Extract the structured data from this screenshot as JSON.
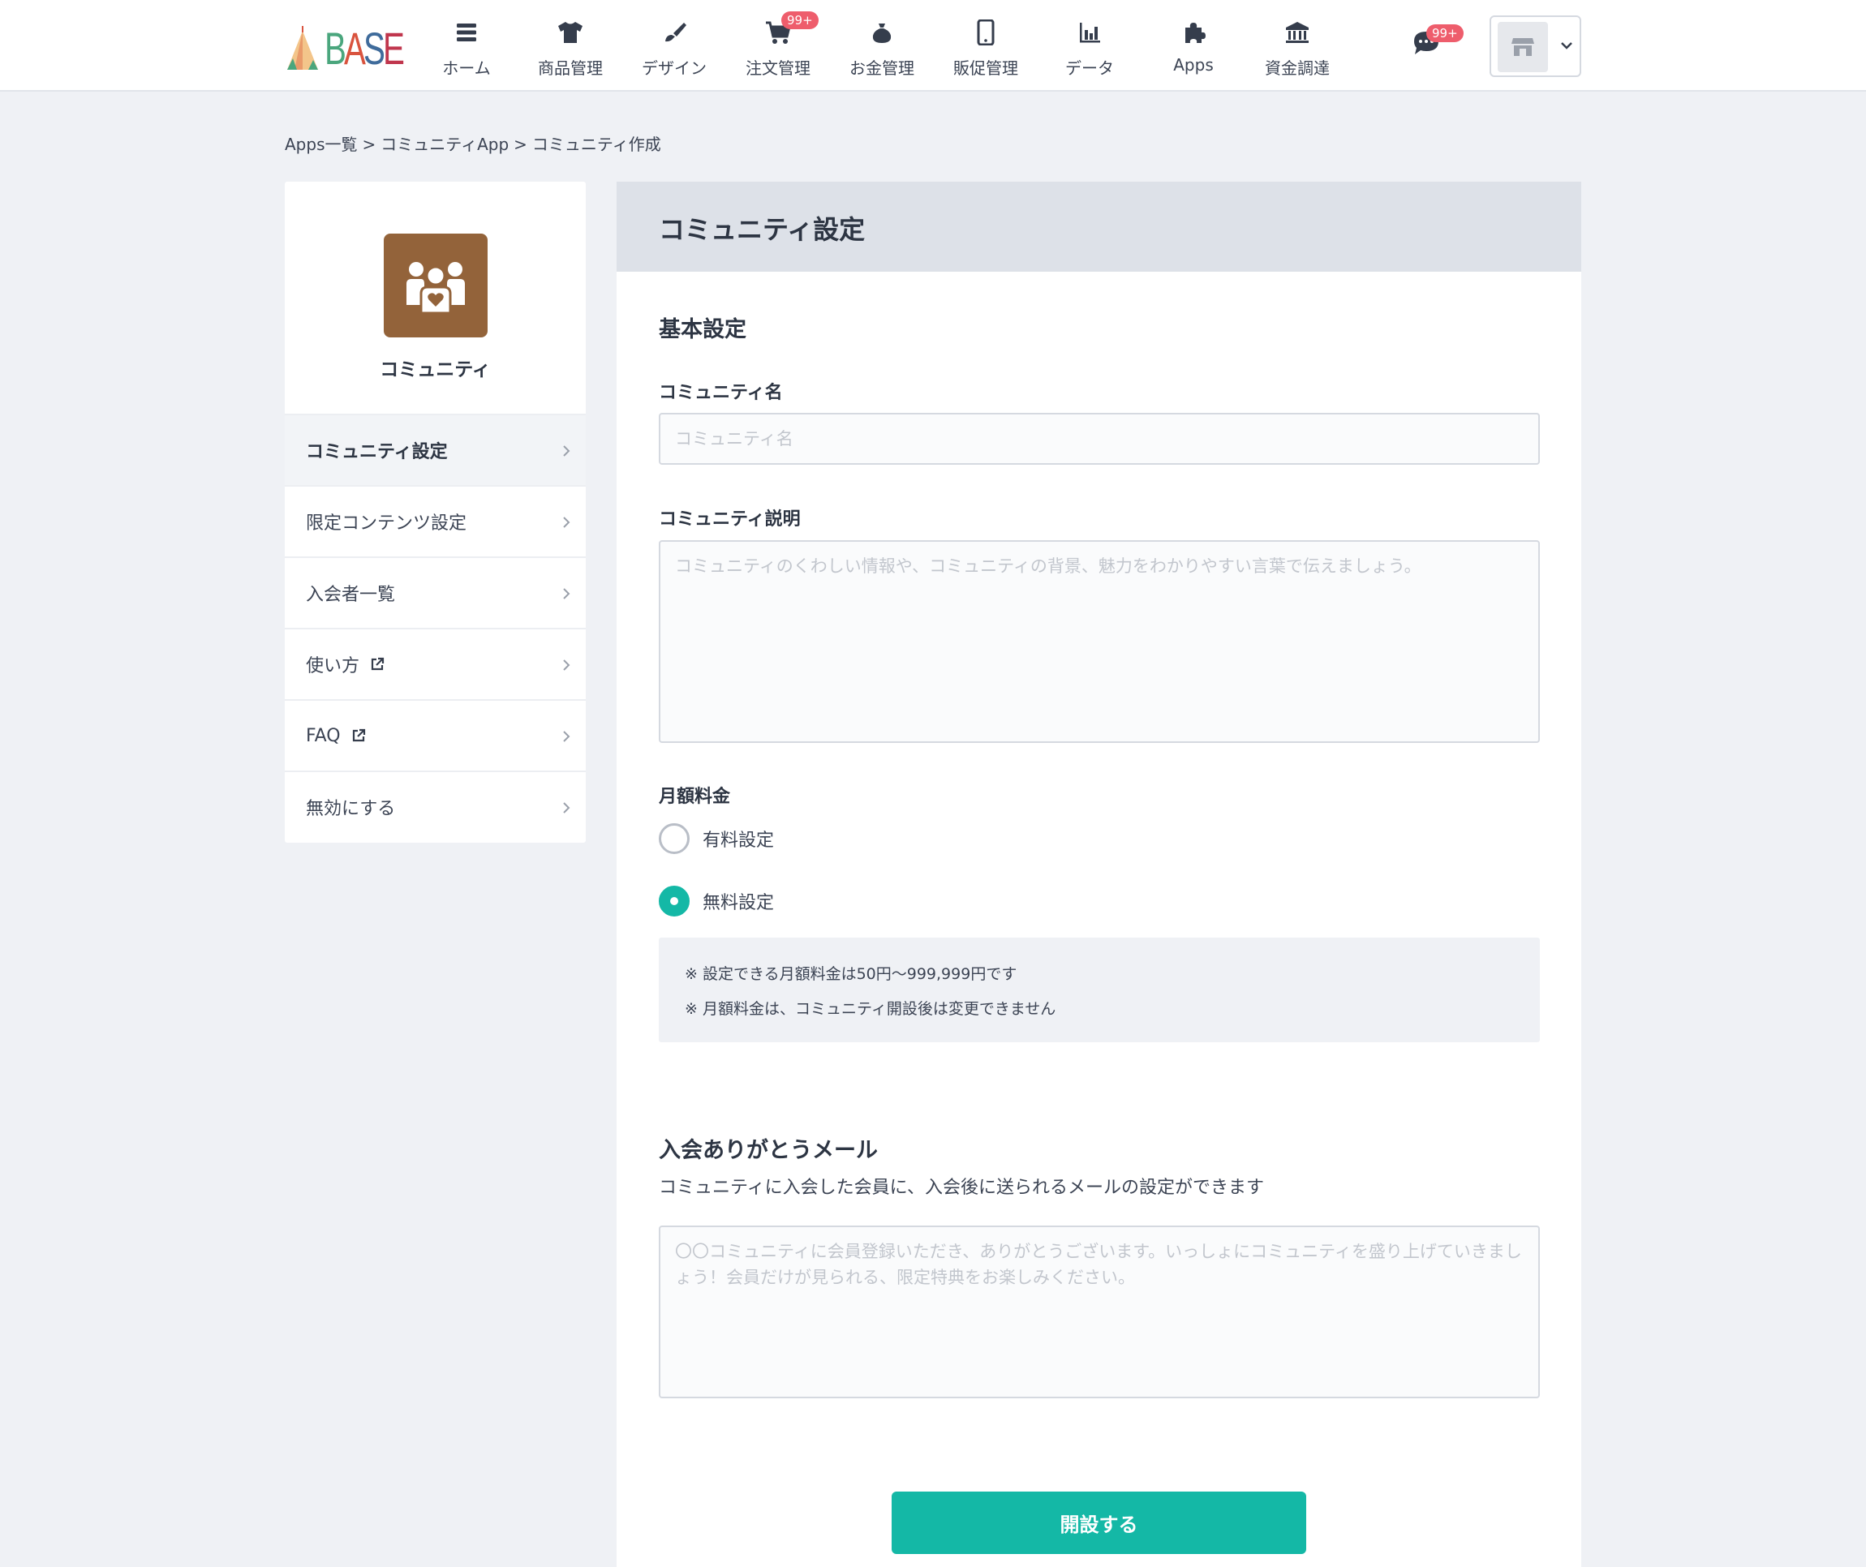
{
  "header": {
    "logo_text": "BASE",
    "nav": [
      {
        "label": "ホーム",
        "icon": "home-list-icon"
      },
      {
        "label": "商品管理",
        "icon": "tshirt-icon"
      },
      {
        "label": "デザイン",
        "icon": "brush-icon"
      },
      {
        "label": "注文管理",
        "icon": "cart-icon",
        "badge": "99+"
      },
      {
        "label": "お金管理",
        "icon": "money-bag-icon"
      },
      {
        "label": "販促管理",
        "icon": "smartphone-icon"
      },
      {
        "label": "データ",
        "icon": "bar-chart-icon"
      },
      {
        "label": "Apps",
        "icon": "puzzle-icon"
      },
      {
        "label": "資金調達",
        "icon": "bank-icon"
      }
    ],
    "chat_badge": "99+",
    "accent_color": "#14b8a6",
    "badge_color": "#ee5d6c"
  },
  "breadcrumb": [
    {
      "label": "Apps一覧"
    },
    {
      "label": "コミュニティApp"
    },
    {
      "label": "コミュニティ作成"
    }
  ],
  "breadcrumb_sep": ">",
  "sidebar": {
    "app_name": "コミュニティ",
    "app_icon_color": "#93633a",
    "items": [
      {
        "label": "コミュニティ設定",
        "active": true
      },
      {
        "label": "限定コンテンツ設定"
      },
      {
        "label": "入会者一覧"
      },
      {
        "label": "使い方",
        "external": true
      },
      {
        "label": "FAQ",
        "external": true
      },
      {
        "label": "無効にする"
      }
    ]
  },
  "main": {
    "title": "コミュニティ設定",
    "basic": {
      "title": "基本設定",
      "name_label": "コミュニティ名",
      "name_placeholder": "コミュニティ名",
      "name_value": "",
      "desc_label": "コミュニティ説明",
      "desc_placeholder": "コミュニティのくわしい情報や、コミュニティの背景、魅力をわかりやすい言葉で伝えましょう。",
      "desc_value": ""
    },
    "fee": {
      "label": "月額料金",
      "options": [
        {
          "label": "有料設定",
          "checked": false
        },
        {
          "label": "無料設定",
          "checked": true
        }
      ],
      "notes": [
        "※ 設定できる月額料金は50円〜999,999円です",
        "※ 月額料金は、コミュニティ開設後は変更できません"
      ]
    },
    "mail": {
      "title": "入会ありがとうメール",
      "description": "コミュニティに入会した会員に、入会後に送られるメールの設定ができます",
      "placeholder": "〇〇コミュニティに会員登録いただき、ありがとうございます。いっしょにコミュニティを盛り上げていきましょう！会員だけが見られる、限定特典をお楽しみください。",
      "value": ""
    },
    "submit_label": "開設する"
  }
}
